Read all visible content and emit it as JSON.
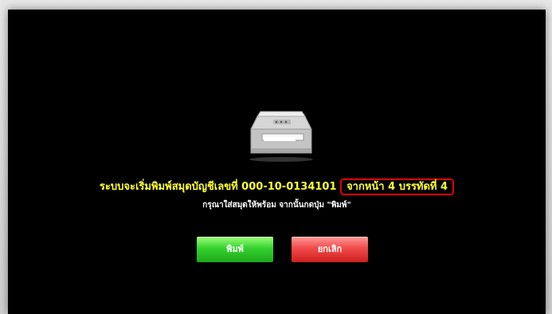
{
  "message": {
    "main": "ระบบจะเริ่มพิมพ์สมุดบัญชีเลขที่ 000-10-0134101",
    "highlighted": "จากหน้า 4 บรรทัดที่ 4",
    "instruction": "กรุณาใส่สมุดให้พร้อม จากนั้นกดปุ่ม \"พิมพ์\""
  },
  "buttons": {
    "print_label": "พิมพ์",
    "cancel_label": "ยกเลิก"
  },
  "icons": {
    "printer": "printer-icon"
  },
  "colors": {
    "message": "#ffff33",
    "highlight_border": "#e00000",
    "print_button": "#34d22f",
    "cancel_button": "#f24a4a",
    "background": "#000000"
  }
}
